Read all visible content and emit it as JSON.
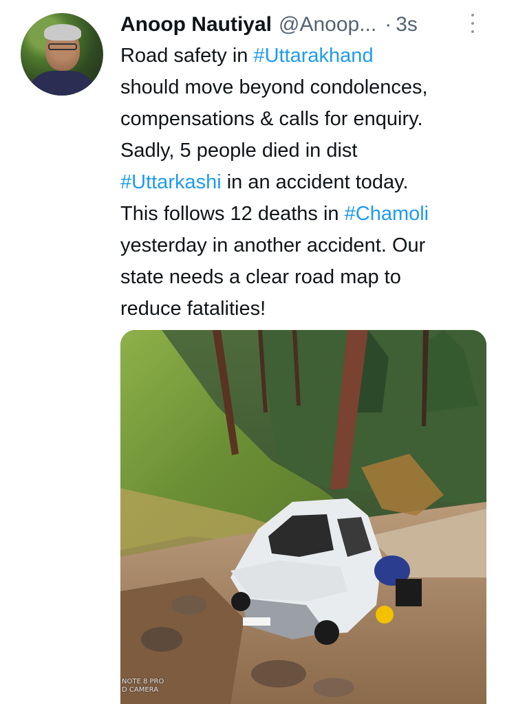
{
  "tweet": {
    "author_name": "Anoop Nautiyal",
    "author_handle": "@Anoop...",
    "separator": "·",
    "timestamp": "3s",
    "text_lines": [
      [
        {
          "t": "Road safety in "
        },
        {
          "t": "#Uttarakhand",
          "tag": true
        }
      ],
      [
        {
          "t": "should move beyond condolences,"
        }
      ],
      [
        {
          "t": "compensations & calls for enquiry."
        }
      ],
      [
        {
          "t": "Sadly, 5 people died in dist"
        }
      ],
      [
        {
          "t": "#Uttarkashi",
          "tag": true
        },
        {
          "t": " in an accident today."
        }
      ],
      [
        {
          "t": "This follows 12 deaths in "
        },
        {
          "t": "#Chamoli",
          "tag": true
        }
      ],
      [
        {
          "t": "yesterday in another accident. Our"
        }
      ],
      [
        {
          "t": "state needs a clear road map to"
        }
      ],
      [
        {
          "t": "reduce fatalities!"
        }
      ]
    ],
    "hashtag_color": "#1d9bf0",
    "media": {
      "alt_watermark": "NOTE 8 PRO\nD CAMERA"
    }
  },
  "icons": {
    "more": "more-vertical-icon",
    "avatar": "avatar"
  }
}
